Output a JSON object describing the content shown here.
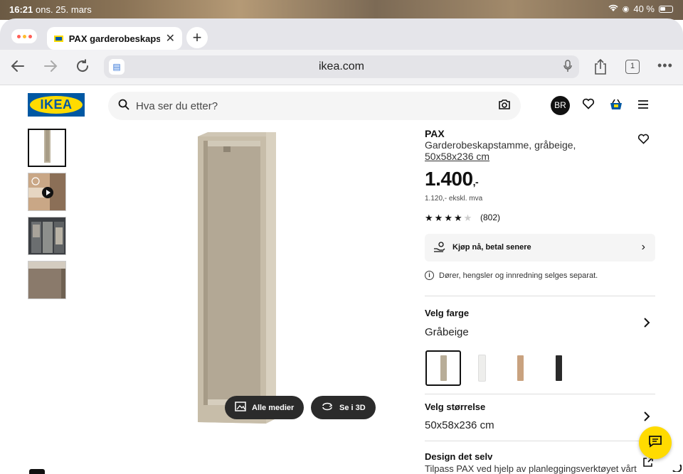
{
  "status_bar": {
    "time": "16:21",
    "date": "ons. 25. mars",
    "battery": "40 %"
  },
  "browser": {
    "tab_title": "PAX garderobeskapstamme",
    "url": "ikea.com",
    "tab_count": "1"
  },
  "header": {
    "logo_text": "IKEA",
    "search_placeholder": "Hva ser du etter?",
    "avatar_initials": "BR"
  },
  "gallery": {
    "buttons": {
      "all_media": "Alle medier",
      "view_3d": "Se i 3D"
    }
  },
  "product": {
    "brand": "PAX",
    "name": "Garderobeskapstamme, gråbeige,",
    "size_link": "50x58x236 cm",
    "price": "1.400",
    "price_suffix": ",-",
    "price_ex_vat": "1.120,- ekskl. mva",
    "rating": 4,
    "rating_max": 5,
    "review_count": "(802)",
    "pay_later": "Kjøp nå, betal senere",
    "notice": "Dører, hengsler og innredning selges separat."
  },
  "color_section": {
    "title": "Velg farge",
    "value": "Gråbeige",
    "swatches": [
      {
        "name": "gråbeige",
        "color": "#b8ad98"
      },
      {
        "name": "hvit",
        "color": "#eeeeec"
      },
      {
        "name": "eik",
        "color": "#c9a27f"
      },
      {
        "name": "svart",
        "color": "#2a2a2a"
      }
    ]
  },
  "size_section": {
    "title": "Velg størrelse",
    "value": "50x58x236 cm"
  },
  "design_section": {
    "title": "Design det selv",
    "subtitle": "Tilpass PAX ved hjelp av planleggingsverktøyet vårt"
  },
  "colors": {
    "ikea_blue": "#0058a3",
    "ikea_yellow": "#ffdb00"
  }
}
